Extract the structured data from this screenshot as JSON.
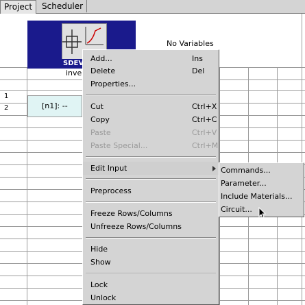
{
  "tabs": [
    {
      "label": "Project"
    },
    {
      "label": "Scheduler"
    }
  ],
  "grid": {
    "tool_label": "SDEV",
    "header_text": "No Variables",
    "column_label": "inver",
    "row_numbers": [
      "1",
      "2"
    ],
    "cell_value": "[n1]: --"
  },
  "context_menu": {
    "items": [
      {
        "label": "Add...",
        "shortcut": "Ins",
        "enabled": true
      },
      {
        "label": "Delete",
        "shortcut": "Del",
        "enabled": true
      },
      {
        "label": "Properties...",
        "shortcut": "",
        "enabled": true
      },
      {
        "label": "Cut",
        "shortcut": "Ctrl+X",
        "enabled": true
      },
      {
        "label": "Copy",
        "shortcut": "Ctrl+C",
        "enabled": true
      },
      {
        "label": "Paste",
        "shortcut": "Ctrl+V",
        "enabled": false
      },
      {
        "label": "Paste Special...",
        "shortcut": "Ctrl+M",
        "enabled": false
      },
      {
        "label": "Edit Input",
        "shortcut": "",
        "enabled": true
      },
      {
        "label": "Preprocess",
        "shortcut": "",
        "enabled": true
      },
      {
        "label": "Freeze Rows/Columns",
        "shortcut": "",
        "enabled": true
      },
      {
        "label": "Unfreeze Rows/Columns",
        "shortcut": "",
        "enabled": true
      },
      {
        "label": "Hide",
        "shortcut": "",
        "enabled": true
      },
      {
        "label": "Show",
        "shortcut": "",
        "enabled": true
      },
      {
        "label": "Lock",
        "shortcut": "",
        "enabled": true
      },
      {
        "label": "Unlock",
        "shortcut": "",
        "enabled": true
      }
    ]
  },
  "submenu": {
    "items": [
      {
        "label": "Commands..."
      },
      {
        "label": "Parameter..."
      },
      {
        "label": "Include Materials..."
      },
      {
        "label": "Circuit..."
      }
    ]
  },
  "colors": {
    "menu_bg": "#d4d4d4",
    "tool_header_bg": "#1a1a8c",
    "selected_cell_bg": "#e0f4f4",
    "marker": "#f0c000"
  }
}
